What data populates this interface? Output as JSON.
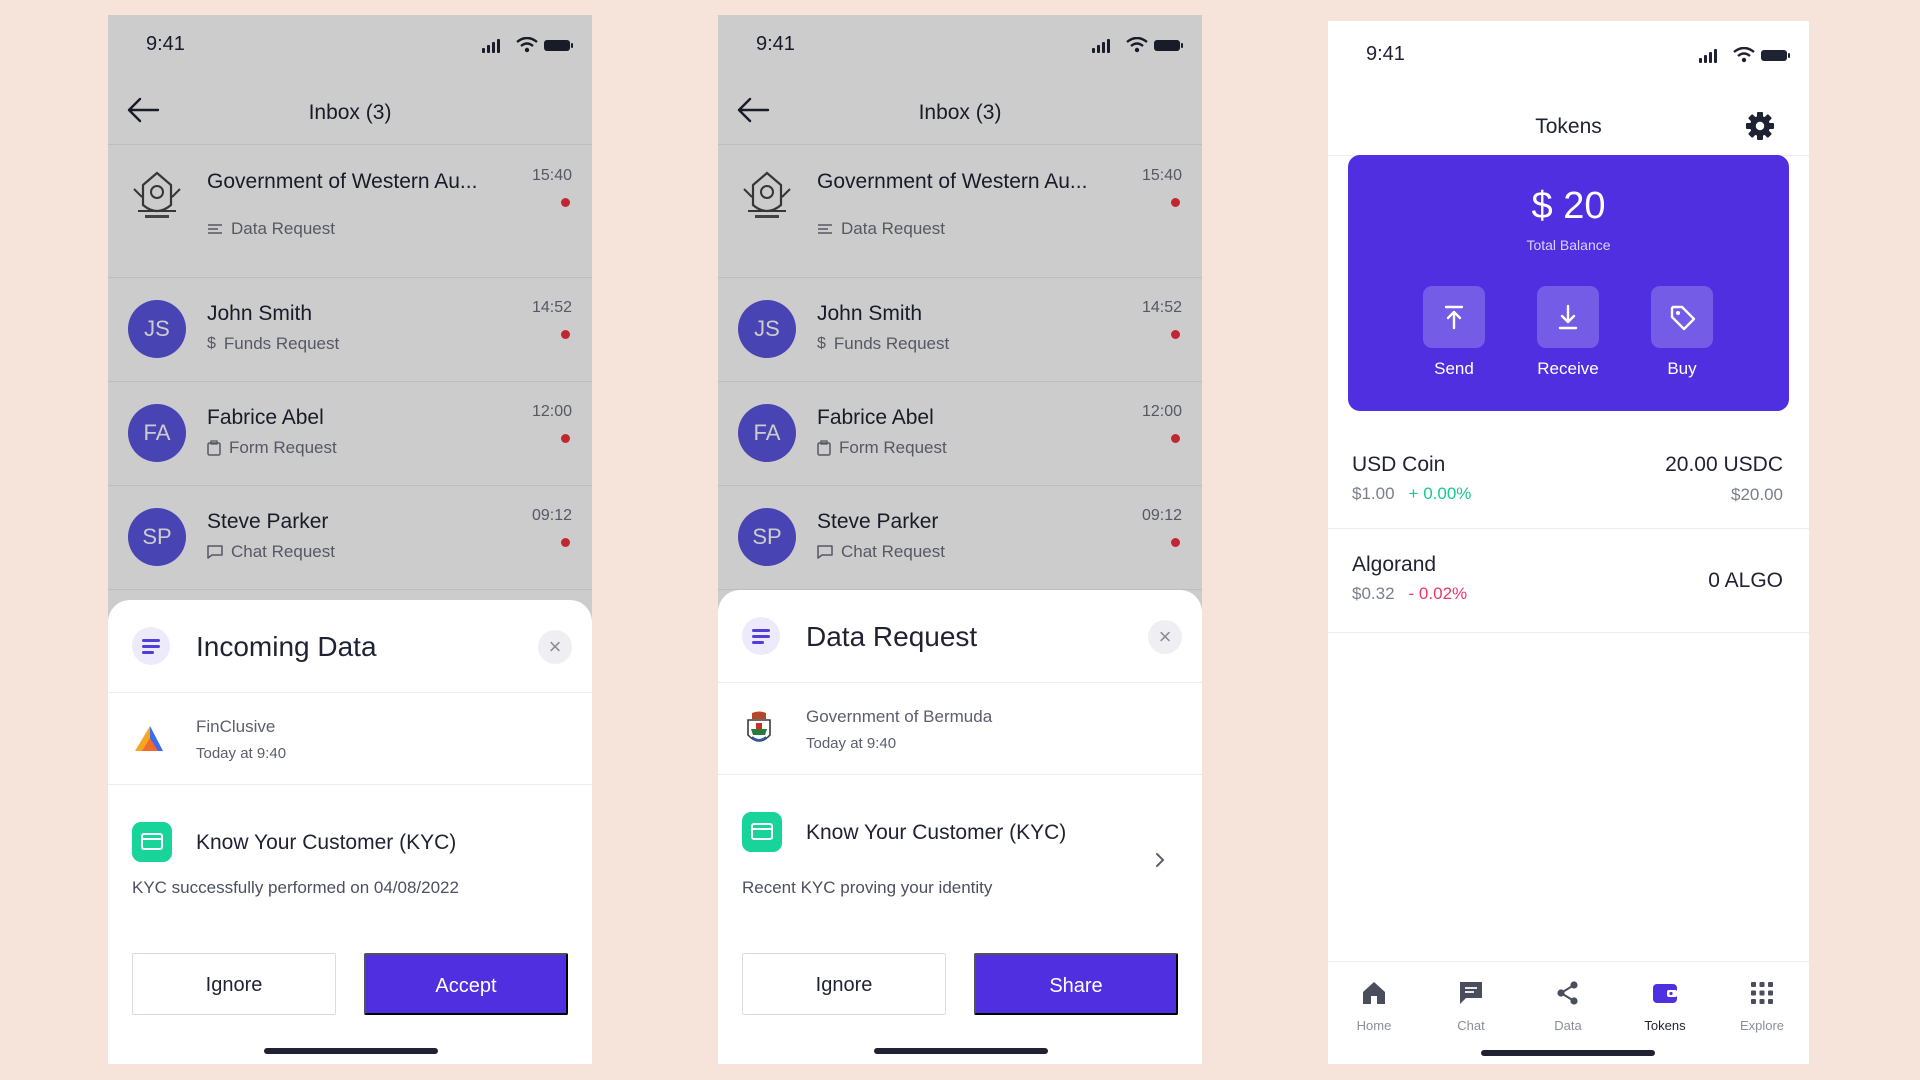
{
  "status_time": "9:41",
  "inbox": {
    "title": "Inbox (3)",
    "rows": [
      {
        "name": "Government of Western Au...",
        "sub": "Data Request",
        "time": "15:40",
        "initials": "",
        "unread": true
      },
      {
        "name": "John Smith",
        "sub": "Funds Request",
        "time": "14:52",
        "initials": "JS",
        "unread": true
      },
      {
        "name": "Fabrice Abel",
        "sub": "Form Request",
        "time": "12:00",
        "initials": "FA",
        "unread": true
      },
      {
        "name": "Steve Parker",
        "sub": "Chat Request",
        "time": "09:12",
        "initials": "SP",
        "unread": true
      }
    ]
  },
  "sheet_incoming": {
    "title": "Incoming Data",
    "sender": "FinClusive",
    "sender_time": "Today at 9:40",
    "item_title": "Know Your Customer (KYC)",
    "item_desc": "KYC successfully performed on 04/08/2022",
    "ignore_label": "Ignore",
    "accept_label": "Accept"
  },
  "sheet_request": {
    "title": "Data Request",
    "sender": "Government of Bermuda",
    "sender_time": "Today at 9:40",
    "item_title": "Know Your Customer (KYC)",
    "item_desc": "Recent KYC proving your identity",
    "ignore_label": "Ignore",
    "share_label": "Share"
  },
  "tokens": {
    "title": "Tokens",
    "balance": "$ 20",
    "balance_label": "Total Balance",
    "actions": [
      "Send",
      "Receive",
      "Buy"
    ],
    "list": [
      {
        "name": "USD Coin",
        "price": "$1.00",
        "change": "+ 0.00%",
        "direction": "up",
        "qty": "20.00 USDC",
        "usd": "$20.00"
      },
      {
        "name": "Algorand",
        "price": "$0.32",
        "change": "- 0.02%",
        "direction": "down",
        "qty": "0 ALGO",
        "usd": ""
      }
    ],
    "tabs": [
      "Home",
      "Chat",
      "Data",
      "Tokens",
      "Explore"
    ],
    "active_tab": "Tokens"
  },
  "colors": {
    "background": "#f6e3da",
    "primary": "#4f2fe0",
    "avatar": "#5a55e0",
    "unread_dot": "#f0323d",
    "positive": "#16c98c",
    "negative": "#f0356b",
    "kyc": "#19d49a"
  }
}
